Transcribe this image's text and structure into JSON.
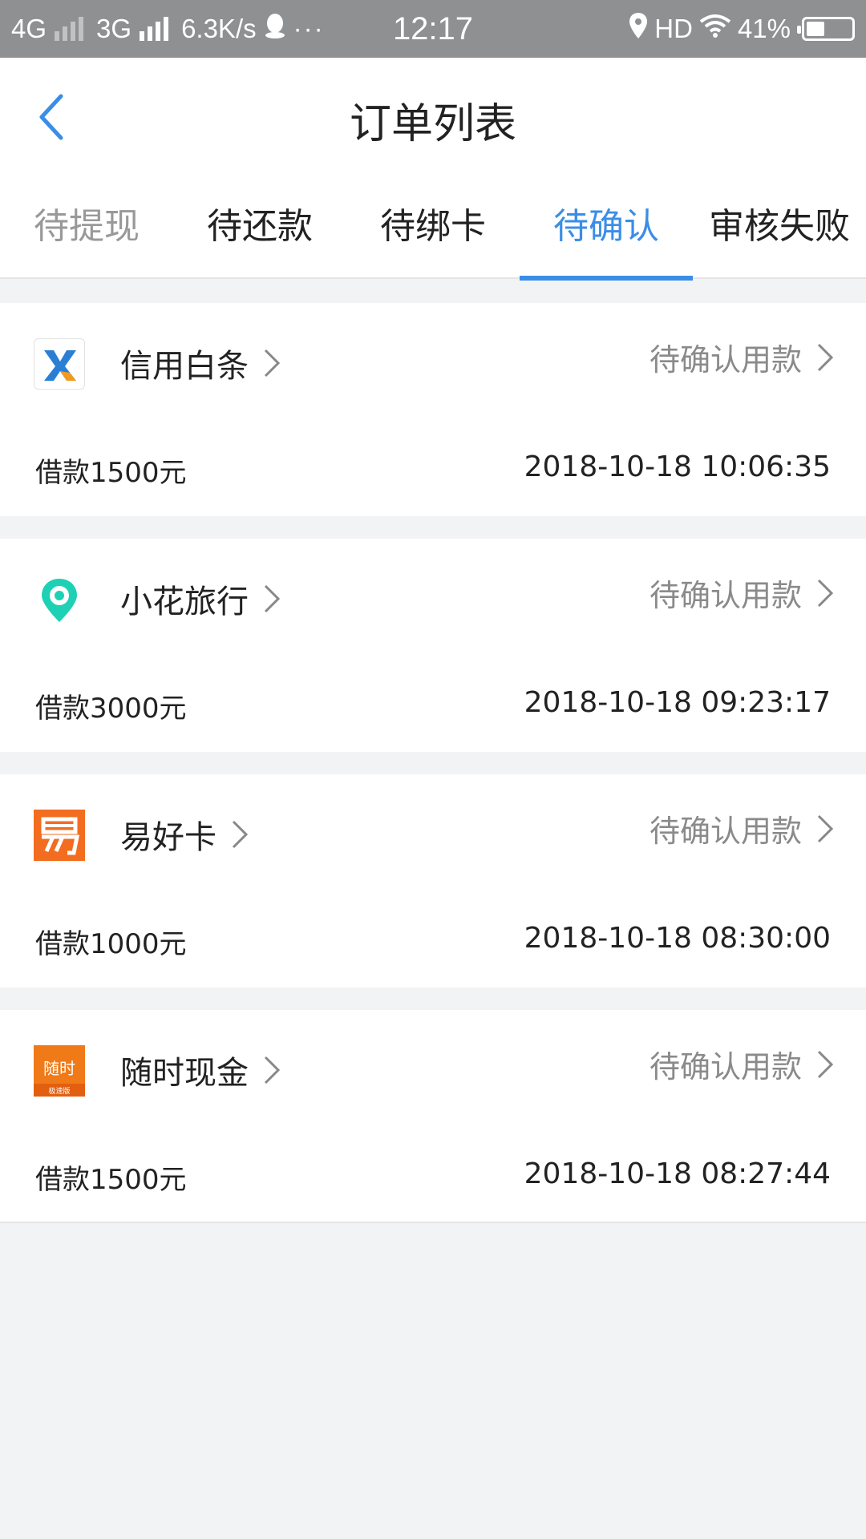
{
  "status_bar": {
    "network_1": "4G",
    "network_2": "3G",
    "speed": "6.3K/s",
    "dots": "···",
    "time": "12:17",
    "hd": "HD",
    "battery": "41%",
    "battery_level": 0.41
  },
  "header": {
    "title": "订单列表"
  },
  "tabs": [
    {
      "label": "待提现"
    },
    {
      "label": "待还款"
    },
    {
      "label": "待绑卡"
    },
    {
      "label": "待确认"
    },
    {
      "label": "审核失败"
    }
  ],
  "active_tab": "待确认",
  "orders": [
    {
      "name": "信用白条",
      "status": "待确认用款",
      "amount": "借款1500元",
      "time": "2018-10-18 10:06:35",
      "logo": "xinyong-baitiao-logo"
    },
    {
      "name": "小花旅行",
      "status": "待确认用款",
      "amount": "借款3000元",
      "time": "2018-10-18 09:23:17",
      "logo": "xiaohua-lvxing-logo"
    },
    {
      "name": "易好卡",
      "status": "待确认用款",
      "amount": "借款1000元",
      "time": "2018-10-18 08:30:00",
      "logo": "yihaoka-logo"
    },
    {
      "name": "随时现金",
      "status": "待确认用款",
      "amount": "借款1500元",
      "time": "2018-10-18 08:27:44",
      "logo": "suishi-xianjin-logo",
      "logo_text": "随时",
      "logo_subtext": "极速版"
    }
  ],
  "colors": {
    "accent": "#3a8ee6",
    "status_bar": "#8e9092",
    "background": "#f2f3f5"
  }
}
